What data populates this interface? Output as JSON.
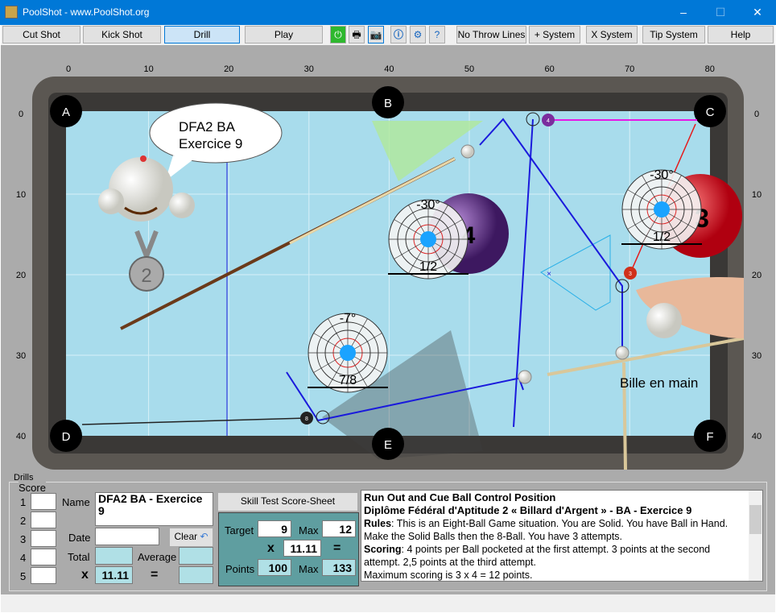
{
  "window": {
    "title": "PoolShot - www.PoolShot.org",
    "minimize": "–",
    "maximize": "☐",
    "close": "✕"
  },
  "toolbar": {
    "buttons": [
      "Cut Shot",
      "Kick Shot",
      "Drill",
      "Play"
    ],
    "active": "Drill",
    "icons": [
      "power-icon",
      "print-icon",
      "camera-icon",
      "info-icon",
      "settings-icon",
      "help-document-icon"
    ],
    "buttons2": [
      "No Throw Lines",
      "+ System",
      "X System",
      "Tip System",
      "Help"
    ]
  },
  "table": {
    "x_ticks": [
      "0",
      "10",
      "20",
      "30",
      "40",
      "50",
      "60",
      "70",
      "80"
    ],
    "y_ticks": [
      "0",
      "10",
      "20",
      "30",
      "40"
    ],
    "pockets": [
      "A",
      "B",
      "C",
      "D",
      "E",
      "F"
    ],
    "bubble": [
      "DFA2 BA",
      "Exercice 9"
    ],
    "medal": "2",
    "ball_in_hand": "Bille en main",
    "diagrams": [
      {
        "angle": "-30°",
        "fraction": "1/2",
        "ball": "4"
      },
      {
        "angle": "-30°",
        "fraction": "1/2",
        "ball": "3"
      },
      {
        "angle": "-7°",
        "fraction": "7/8"
      }
    ],
    "balls": [
      "4",
      "3",
      "8"
    ],
    "colors": {
      "felt": "#a8dcec",
      "blue_path": "#1a1adc",
      "pink": "#e619e6",
      "red": "#e61919"
    }
  },
  "drills": {
    "group": "Drills",
    "score_group": "Score",
    "rows": [
      "1",
      "2",
      "3",
      "4",
      "5"
    ],
    "name_label": "Name",
    "name_value": "DFA2 BA - Exercice 9",
    "date_label": "Date",
    "date_value": "",
    "clear": "Clear",
    "total_label": "Total",
    "average_label": "Average",
    "x": "x",
    "eq": "=",
    "factor": "11.11",
    "sheet_button": "Skill Test Score-Sheet",
    "target_label": "Target",
    "target": "9",
    "max_label": "Max",
    "max": "12",
    "multiplier": "11.11",
    "points_label": "Points",
    "points": "100",
    "points_max": "133",
    "desc": {
      "title": "Run Out and Cue Ball Control Position",
      "subtitle": "Diplôme Fédéral d'Aptitude 2 « Billard d'Argent » - BA - Exercice 9",
      "rules_label": "Rules",
      "rules": ": This is an Eight-Ball Game situation. You are Solid. You have Ball in Hand. Make the Solid Balls then the 8-Ball. You have 3 attempts.",
      "scoring_label": "Scoring",
      "scoring": ": 4 points per Ball pocketed at the first attempt. 3 points at the second attempt. 2,5 points at the third attempt.",
      "max_line": "Maximum scoring is 3 x 4 = 12 points."
    }
  }
}
